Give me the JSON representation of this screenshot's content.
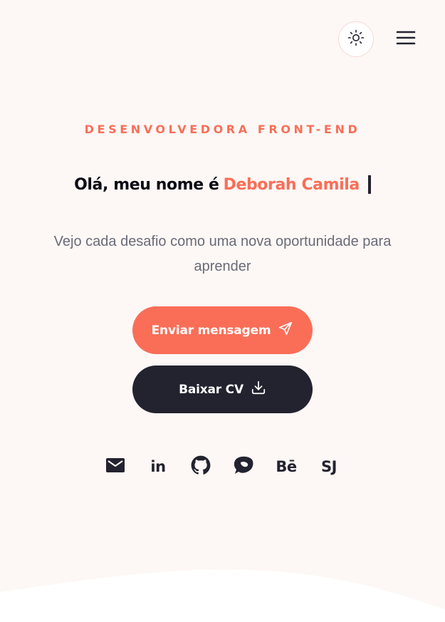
{
  "header": {
    "theme_toggle_icon": "sun-icon",
    "menu_icon": "hamburger-menu-icon"
  },
  "hero": {
    "eyebrow": "DESENVOLVEDORA FRONT-END",
    "greeting_prefix": "Olá, meu nome é",
    "name": "Deborah Camila",
    "tagline": "Vejo cada desafio como uma nova oportunidade para aprender"
  },
  "actions": {
    "send_message_label": "Enviar mensagem",
    "send_message_icon": "paper-plane-icon",
    "download_cv_label": "Baixar CV",
    "download_cv_icon": "download-icon"
  },
  "socials": [
    {
      "name": "email",
      "icon": "mail-icon"
    },
    {
      "name": "linkedin",
      "icon": "linkedin-icon",
      "text": "in"
    },
    {
      "name": "github",
      "icon": "github-icon"
    },
    {
      "name": "blog",
      "icon": "blog-icon"
    },
    {
      "name": "behance",
      "icon": "behance-icon",
      "text": "Bē"
    },
    {
      "name": "sj",
      "icon": "sj-icon",
      "text": "SJ"
    }
  ],
  "colors": {
    "background": "#fdf8f5",
    "accent": "#fa6e58",
    "dark": "#23222f",
    "muted_text": "#6b6a78"
  }
}
